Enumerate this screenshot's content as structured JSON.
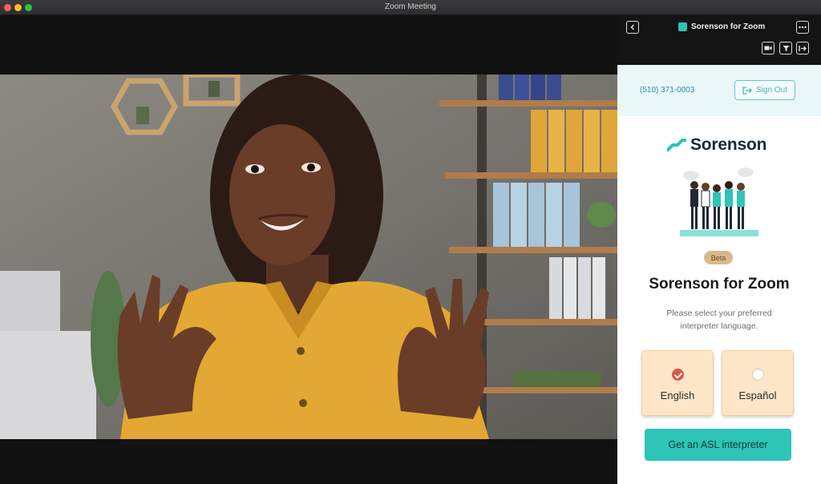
{
  "window": {
    "title": "Zoom Meeting"
  },
  "panel": {
    "header_title": "Sorenson for Zoom",
    "phone": "(510) 371-0003",
    "sign_out_label": "Sign Out",
    "brand_name": "Sorenson",
    "beta_badge": "Beta",
    "title": "Sorenson for Zoom",
    "subtitle": "Please select your preferred interpreter language.",
    "languages": [
      {
        "label": "English",
        "selected": true
      },
      {
        "label": "Español",
        "selected": false
      }
    ],
    "cta_label": "Get an ASL interpreter"
  },
  "icons": {
    "back": "chevron-left-icon",
    "more": "more-horizontal-icon",
    "video": "video-icon",
    "filter": "filter-icon",
    "exit": "exit-icon",
    "sign_out": "sign-out-icon"
  },
  "colors": {
    "accent": "#2ec4b6",
    "header_bg": "#141414",
    "account_bg": "#eaf7f9",
    "option_bg": "#fde6c8",
    "selected": "#d9574c",
    "beta_bg": "#d9b98a"
  }
}
